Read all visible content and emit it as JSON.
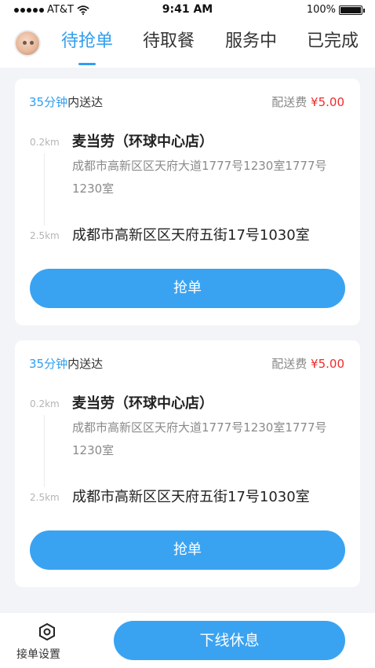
{
  "status_bar": {
    "carrier": "AT&T",
    "time": "9:41 AM",
    "battery": "100%",
    "icons": [
      "signal-dots-icon",
      "wifi-icon",
      "battery-icon"
    ]
  },
  "header": {
    "tabs": [
      {
        "label": "待抢单",
        "active": true
      },
      {
        "label": "待取餐",
        "active": false
      },
      {
        "label": "服务中",
        "active": false
      },
      {
        "label": "已完成",
        "active": false
      }
    ]
  },
  "orders": [
    {
      "time_minutes": "35分钟",
      "time_suffix": "内送达",
      "fee_label": "配送费",
      "fee_amount": "¥5.00",
      "pickup_distance": "0.2km",
      "shop_name": "麦当劳（环球中心店）",
      "shop_address": "成都市高新区区天府大道1777号1230室1777号1230室",
      "dest_distance": "2.5km",
      "dest_address": "成都市高新区区天府五街17号1030室",
      "button_label": "抢单"
    },
    {
      "time_minutes": "35分钟",
      "time_suffix": "内送达",
      "fee_label": "配送费",
      "fee_amount": "¥5.00",
      "pickup_distance": "0.2km",
      "shop_name": "麦当劳（环球中心店）",
      "shop_address": "成都市高新区区天府大道1777号1230室1777号1230室",
      "dest_distance": "2.5km",
      "dest_address": "成都市高新区区天府五街17号1030室",
      "button_label": "抢单"
    }
  ],
  "bottom_bar": {
    "settings_label": "接单设置",
    "settings_icon": "hexagon-nut-icon",
    "offline_label": "下线休息"
  },
  "colors": {
    "accent": "#2f9ef0",
    "button": "#3aa3f1",
    "price": "#ef2b2b",
    "background": "#f2f4f7"
  }
}
